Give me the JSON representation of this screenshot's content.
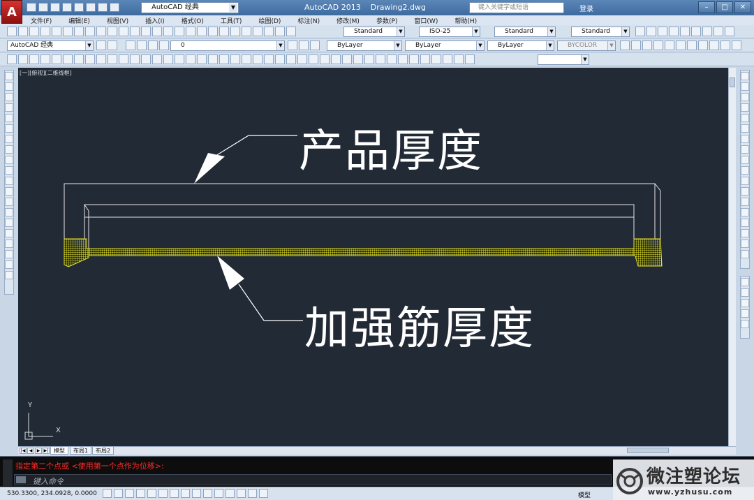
{
  "titlebar": {
    "workspace": "AutoCAD 经典",
    "app_name": "AutoCAD 2013",
    "document": "Drawing2.dwg",
    "search_placeholder": "键入关键字或短语",
    "login": "登录"
  },
  "menu": [
    "文件(F)",
    "编辑(E)",
    "视图(V)",
    "插入(I)",
    "格式(O)",
    "工具(T)",
    "绘图(D)",
    "标注(N)",
    "修改(M)",
    "参数(P)",
    "窗口(W)",
    "帮助(H)"
  ],
  "toolbar": {
    "text_style": "Standard",
    "dim_style": "ISO-25",
    "table_style": "Standard",
    "multileader_style": "Standard",
    "workspace2": "AutoCAD 经典",
    "layer": "0",
    "color": "ByLayer",
    "linetype": "ByLayer",
    "lineweight": "ByLayer",
    "plot_style": "BYCOLOR"
  },
  "viewport_label": "[一][俯视][二维线框]",
  "annotations": {
    "product_thickness": "产品厚度",
    "rib_thickness": "加强筋厚度"
  },
  "ucs": {
    "y": "Y",
    "x": "X"
  },
  "layout_tabs": [
    "模型",
    "布局1",
    "布局2"
  ],
  "command": {
    "history": "指定第二个点或 <使用第一个点作为位移>:",
    "placeholder": "键入命令"
  },
  "status": {
    "coords": "530.3300, 234.0928, 0.0000",
    "model": "模型"
  },
  "watermark": {
    "text": "微注塑论坛",
    "url": "www.yzhusu.com"
  },
  "colors": {
    "canvas": "#212a35",
    "hatch": "#e8e31a",
    "command_error": "#ff2a2a"
  }
}
